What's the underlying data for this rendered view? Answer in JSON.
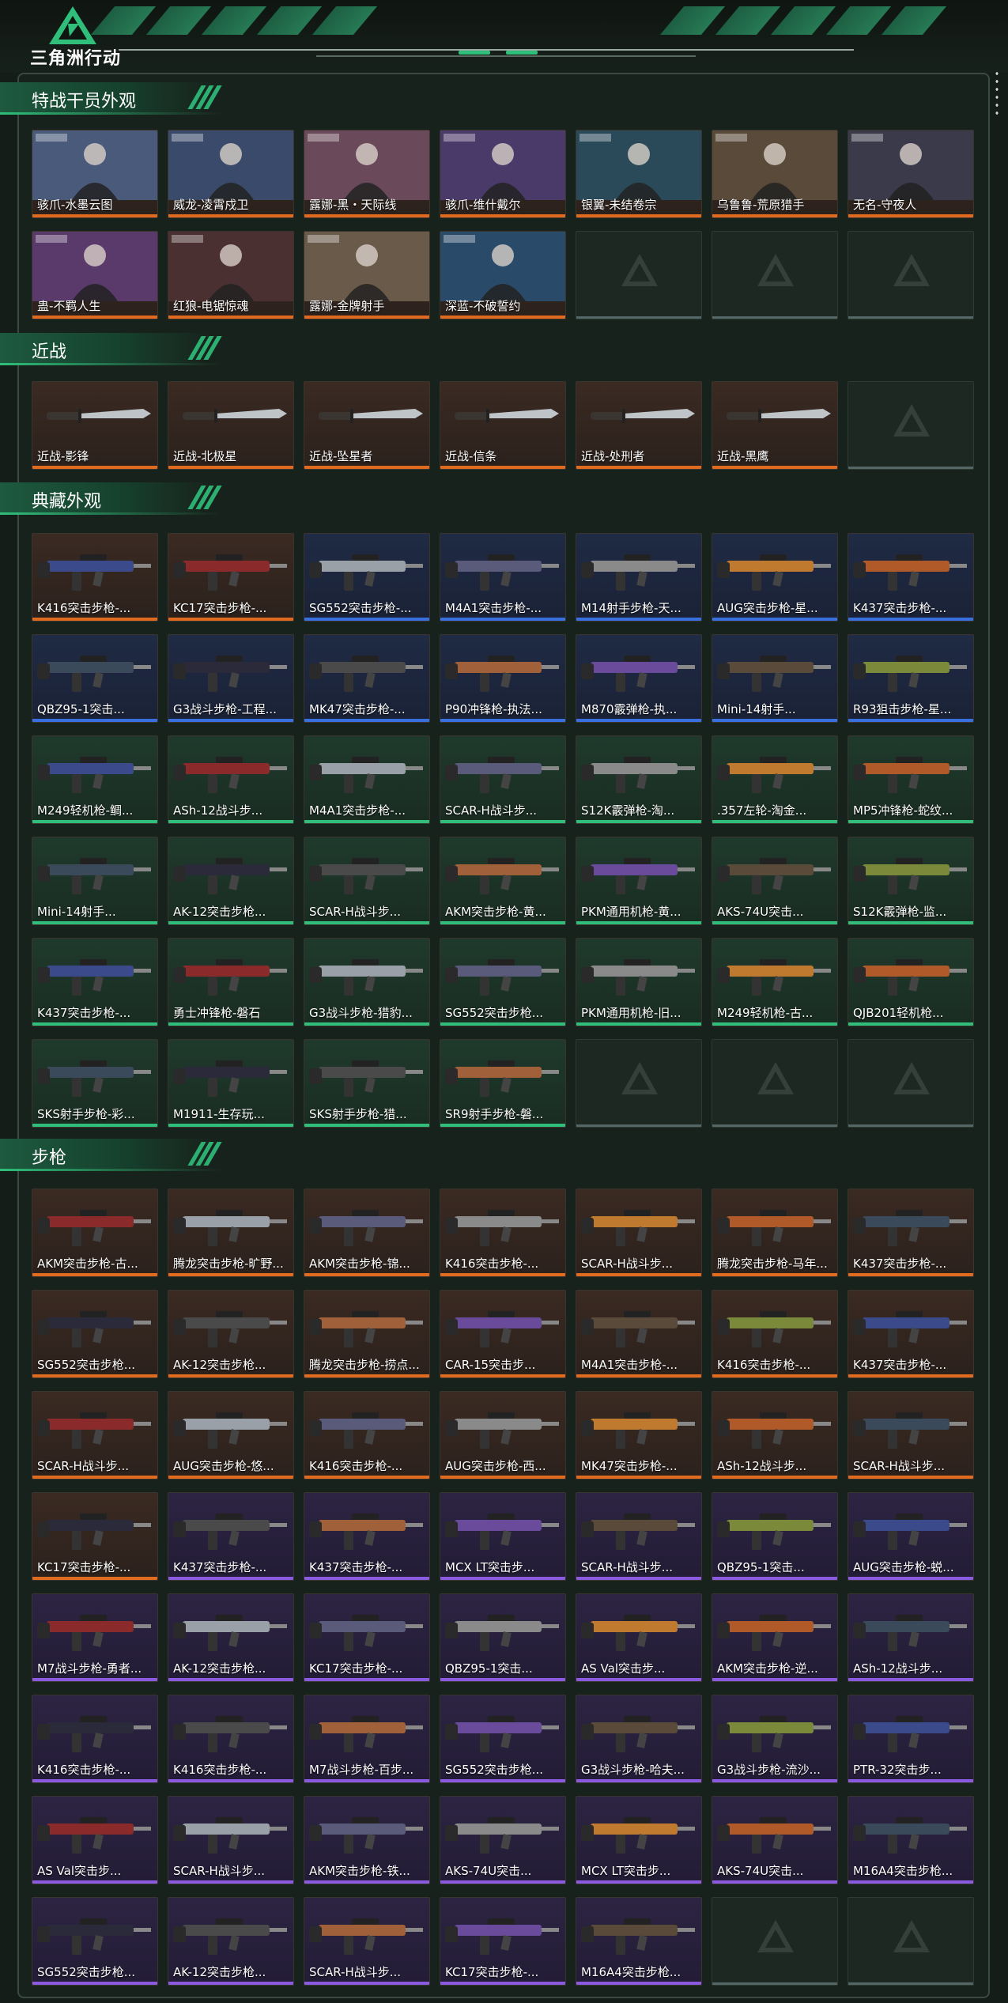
{
  "app": {
    "title": "三角洲行动"
  },
  "colors": {
    "orange": "#e06a1e",
    "blue": "#3a6fe0",
    "green": "#2fbf7a",
    "purple": "#8a5ae0",
    "accent": "#2fbf7a"
  },
  "sections": [
    {
      "title": "特战干员外观",
      "items": [
        {
          "label": "骇爪-水墨云图",
          "rarity": "orange",
          "kind": "operator"
        },
        {
          "label": "威龙-凌霄戍卫",
          "rarity": "orange",
          "kind": "operator"
        },
        {
          "label": "露娜-黑・天际线",
          "rarity": "orange",
          "kind": "operator"
        },
        {
          "label": "骇爪-维什戴尔",
          "rarity": "orange",
          "kind": "operator"
        },
        {
          "label": "银翼-未结卷宗",
          "rarity": "orange",
          "kind": "operator"
        },
        {
          "label": "乌鲁鲁-荒原猎手",
          "rarity": "orange",
          "kind": "operator"
        },
        {
          "label": "无名-守夜人",
          "rarity": "orange",
          "kind": "operator"
        },
        {
          "label": "蛊-不羁人生",
          "rarity": "orange",
          "kind": "operator"
        },
        {
          "label": "红狼-电锯惊魂",
          "rarity": "orange",
          "kind": "operator"
        },
        {
          "label": "露娜-金牌射手",
          "rarity": "orange",
          "kind": "operator"
        },
        {
          "label": "深蓝-不破誓约",
          "rarity": "orange",
          "kind": "operator"
        },
        {
          "label": "",
          "rarity": "empty"
        },
        {
          "label": "",
          "rarity": "empty"
        },
        {
          "label": "",
          "rarity": "empty"
        }
      ]
    },
    {
      "title": "近战",
      "items": [
        {
          "label": "近战-影锋",
          "rarity": "orange",
          "kind": "knife"
        },
        {
          "label": "近战-北极星",
          "rarity": "orange",
          "kind": "knife"
        },
        {
          "label": "近战-坠星者",
          "rarity": "orange",
          "kind": "knife"
        },
        {
          "label": "近战-信条",
          "rarity": "orange",
          "kind": "knife"
        },
        {
          "label": "近战-处刑者",
          "rarity": "orange",
          "kind": "knife"
        },
        {
          "label": "近战-黑鹰",
          "rarity": "orange",
          "kind": "knife"
        },
        {
          "label": "",
          "rarity": "empty"
        }
      ]
    },
    {
      "title": "典藏外观",
      "items": [
        {
          "label": "K416突击步枪-...",
          "rarity": "orange",
          "kind": "gun"
        },
        {
          "label": "KC17突击步枪-...",
          "rarity": "orange",
          "kind": "gun"
        },
        {
          "label": "SG552突击步枪-...",
          "rarity": "blue",
          "kind": "gun"
        },
        {
          "label": "M4A1突击步枪-...",
          "rarity": "blue",
          "kind": "gun"
        },
        {
          "label": "M14射手步枪-天...",
          "rarity": "blue",
          "kind": "gun"
        },
        {
          "label": "AUG突击步枪-星...",
          "rarity": "blue",
          "kind": "gun"
        },
        {
          "label": "K437突击步枪-...",
          "rarity": "blue",
          "kind": "gun"
        },
        {
          "label": "QBZ95-1突击...",
          "rarity": "blue",
          "kind": "gun"
        },
        {
          "label": "G3战斗步枪-工程...",
          "rarity": "blue",
          "kind": "gun"
        },
        {
          "label": "MK47突击步枪-...",
          "rarity": "blue",
          "kind": "gun"
        },
        {
          "label": "P90冲锋枪-执法...",
          "rarity": "blue",
          "kind": "gun"
        },
        {
          "label": "M870霰弹枪-执...",
          "rarity": "blue",
          "kind": "gun"
        },
        {
          "label": "Mini-14射手...",
          "rarity": "blue",
          "kind": "gun"
        },
        {
          "label": "R93狙击步枪-星...",
          "rarity": "blue",
          "kind": "gun"
        },
        {
          "label": "M249轻机枪-鲷...",
          "rarity": "green",
          "kind": "gun"
        },
        {
          "label": "ASh-12战斗步...",
          "rarity": "green",
          "kind": "gun"
        },
        {
          "label": "M4A1突击步枪-...",
          "rarity": "green",
          "kind": "gun"
        },
        {
          "label": "SCAR-H战斗步...",
          "rarity": "green",
          "kind": "gun"
        },
        {
          "label": "S12K霰弹枪-淘...",
          "rarity": "green",
          "kind": "gun"
        },
        {
          "label": ".357左轮-淘金...",
          "rarity": "green",
          "kind": "gun"
        },
        {
          "label": "MP5冲锋枪-蛇纹...",
          "rarity": "green",
          "kind": "gun"
        },
        {
          "label": "Mini-14射手...",
          "rarity": "green",
          "kind": "gun"
        },
        {
          "label": "AK-12突击步枪...",
          "rarity": "green",
          "kind": "gun"
        },
        {
          "label": "SCAR-H战斗步...",
          "rarity": "green",
          "kind": "gun"
        },
        {
          "label": "AKM突击步枪-黄...",
          "rarity": "green",
          "kind": "gun"
        },
        {
          "label": "PKM通用机枪-黄...",
          "rarity": "green",
          "kind": "gun"
        },
        {
          "label": "AKS-74U突击...",
          "rarity": "green",
          "kind": "gun"
        },
        {
          "label": "S12K霰弹枪-监...",
          "rarity": "green",
          "kind": "gun"
        },
        {
          "label": "K437突击步枪-...",
          "rarity": "green",
          "kind": "gun"
        },
        {
          "label": "勇士冲锋枪-磐石",
          "rarity": "green",
          "kind": "gun"
        },
        {
          "label": "G3战斗步枪-猎豹...",
          "rarity": "green",
          "kind": "gun"
        },
        {
          "label": "SG552突击步枪...",
          "rarity": "green",
          "kind": "gun"
        },
        {
          "label": "PKM通用机枪-旧...",
          "rarity": "green",
          "kind": "gun"
        },
        {
          "label": "M249轻机枪-古...",
          "rarity": "green",
          "kind": "gun"
        },
        {
          "label": "QJB201轻机枪...",
          "rarity": "green",
          "kind": "gun"
        },
        {
          "label": "SKS射手步枪-彩...",
          "rarity": "green",
          "kind": "gun"
        },
        {
          "label": "M1911-生存玩...",
          "rarity": "green",
          "kind": "gun"
        },
        {
          "label": "SKS射手步枪-猎...",
          "rarity": "green",
          "kind": "gun"
        },
        {
          "label": "SR9射手步枪-磐...",
          "rarity": "green",
          "kind": "gun"
        },
        {
          "label": "",
          "rarity": "empty"
        },
        {
          "label": "",
          "rarity": "empty"
        },
        {
          "label": "",
          "rarity": "empty"
        }
      ]
    },
    {
      "title": "步枪",
      "items": [
        {
          "label": "AKM突击步枪-古...",
          "rarity": "orange",
          "kind": "gun"
        },
        {
          "label": "腾龙突击步枪-旷野...",
          "rarity": "orange",
          "kind": "gun"
        },
        {
          "label": "AKM突击步枪-锦...",
          "rarity": "orange",
          "kind": "gun"
        },
        {
          "label": "K416突击步枪-...",
          "rarity": "orange",
          "kind": "gun"
        },
        {
          "label": "SCAR-H战斗步...",
          "rarity": "orange",
          "kind": "gun"
        },
        {
          "label": "腾龙突击步枪-马年...",
          "rarity": "orange",
          "kind": "gun"
        },
        {
          "label": "K437突击步枪-...",
          "rarity": "orange",
          "kind": "gun"
        },
        {
          "label": "SG552突击步枪...",
          "rarity": "orange",
          "kind": "gun"
        },
        {
          "label": "AK-12突击步枪...",
          "rarity": "orange",
          "kind": "gun"
        },
        {
          "label": "腾龙突击步枪-捞点...",
          "rarity": "orange",
          "kind": "gun"
        },
        {
          "label": "CAR-15突击步...",
          "rarity": "orange",
          "kind": "gun"
        },
        {
          "label": "M4A1突击步枪-...",
          "rarity": "orange",
          "kind": "gun"
        },
        {
          "label": "K416突击步枪-...",
          "rarity": "orange",
          "kind": "gun"
        },
        {
          "label": "K437突击步枪-...",
          "rarity": "orange",
          "kind": "gun"
        },
        {
          "label": "SCAR-H战斗步...",
          "rarity": "orange",
          "kind": "gun"
        },
        {
          "label": "AUG突击步枪-悠...",
          "rarity": "orange",
          "kind": "gun"
        },
        {
          "label": "K416突击步枪-...",
          "rarity": "orange",
          "kind": "gun"
        },
        {
          "label": "AUG突击步枪-西...",
          "rarity": "orange",
          "kind": "gun"
        },
        {
          "label": "MK47突击步枪-...",
          "rarity": "orange",
          "kind": "gun"
        },
        {
          "label": "ASh-12战斗步...",
          "rarity": "orange",
          "kind": "gun"
        },
        {
          "label": "SCAR-H战斗步...",
          "rarity": "orange",
          "kind": "gun"
        },
        {
          "label": "KC17突击步枪-...",
          "rarity": "orange",
          "kind": "gun"
        },
        {
          "label": "K437突击步枪-...",
          "rarity": "purple",
          "kind": "gun"
        },
        {
          "label": "K437突击步枪-...",
          "rarity": "purple",
          "kind": "gun"
        },
        {
          "label": "MCX LT突击步...",
          "rarity": "purple",
          "kind": "gun"
        },
        {
          "label": "SCAR-H战斗步...",
          "rarity": "purple",
          "kind": "gun"
        },
        {
          "label": "QBZ95-1突击...",
          "rarity": "purple",
          "kind": "gun"
        },
        {
          "label": "AUG突击步枪-蜕...",
          "rarity": "purple",
          "kind": "gun"
        },
        {
          "label": "M7战斗步枪-勇者...",
          "rarity": "purple",
          "kind": "gun"
        },
        {
          "label": "AK-12突击步枪...",
          "rarity": "purple",
          "kind": "gun"
        },
        {
          "label": "KC17突击步枪-...",
          "rarity": "purple",
          "kind": "gun"
        },
        {
          "label": "QBZ95-1突击...",
          "rarity": "purple",
          "kind": "gun"
        },
        {
          "label": "AS Val突击步...",
          "rarity": "purple",
          "kind": "gun"
        },
        {
          "label": "AKM突击步枪-逆...",
          "rarity": "purple",
          "kind": "gun"
        },
        {
          "label": "ASh-12战斗步...",
          "rarity": "purple",
          "kind": "gun"
        },
        {
          "label": "K416突击步枪-...",
          "rarity": "purple",
          "kind": "gun"
        },
        {
          "label": "K416突击步枪-...",
          "rarity": "purple",
          "kind": "gun"
        },
        {
          "label": "M7战斗步枪-百步...",
          "rarity": "purple",
          "kind": "gun"
        },
        {
          "label": "SG552突击步枪...",
          "rarity": "purple",
          "kind": "gun"
        },
        {
          "label": "G3战斗步枪-哈夫...",
          "rarity": "purple",
          "kind": "gun"
        },
        {
          "label": "G3战斗步枪-流沙...",
          "rarity": "purple",
          "kind": "gun"
        },
        {
          "label": "PTR-32突击步...",
          "rarity": "purple",
          "kind": "gun"
        },
        {
          "label": "AS Val突击步...",
          "rarity": "purple",
          "kind": "gun"
        },
        {
          "label": "SCAR-H战斗步...",
          "rarity": "purple",
          "kind": "gun"
        },
        {
          "label": "AKM突击步枪-铁...",
          "rarity": "purple",
          "kind": "gun"
        },
        {
          "label": "AKS-74U突击...",
          "rarity": "purple",
          "kind": "gun"
        },
        {
          "label": "MCX LT突击步...",
          "rarity": "purple",
          "kind": "gun"
        },
        {
          "label": "AKS-74U突击...",
          "rarity": "purple",
          "kind": "gun"
        },
        {
          "label": "M16A4突击步枪...",
          "rarity": "purple",
          "kind": "gun"
        },
        {
          "label": "SG552突击步枪...",
          "rarity": "purple",
          "kind": "gun"
        },
        {
          "label": "AK-12突击步枪...",
          "rarity": "purple",
          "kind": "gun"
        },
        {
          "label": "SCAR-H战斗步...",
          "rarity": "purple",
          "kind": "gun"
        },
        {
          "label": "KC17突击步枪-...",
          "rarity": "purple",
          "kind": "gun"
        },
        {
          "label": "M16A4突击步枪...",
          "rarity": "purple",
          "kind": "gun"
        },
        {
          "label": "",
          "rarity": "empty"
        },
        {
          "label": "",
          "rarity": "empty"
        }
      ]
    }
  ]
}
